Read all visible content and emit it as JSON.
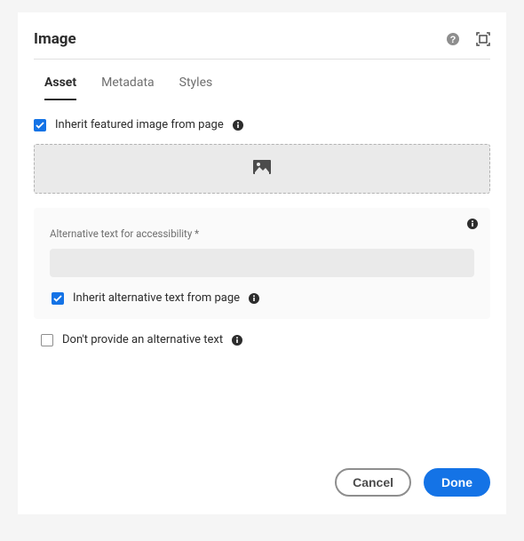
{
  "dialog": {
    "title": "Image"
  },
  "tabs": {
    "asset": "Asset",
    "metadata": "Metadata",
    "styles": "Styles"
  },
  "fields": {
    "inherit_featured_label": "Inherit featured image from page",
    "alt_text_label": "Alternative text for accessibility *",
    "alt_text_value": "",
    "inherit_alt_label": "Inherit alternative text from page",
    "no_alt_label": "Don't provide an alternative text"
  },
  "buttons": {
    "cancel": "Cancel",
    "done": "Done"
  }
}
